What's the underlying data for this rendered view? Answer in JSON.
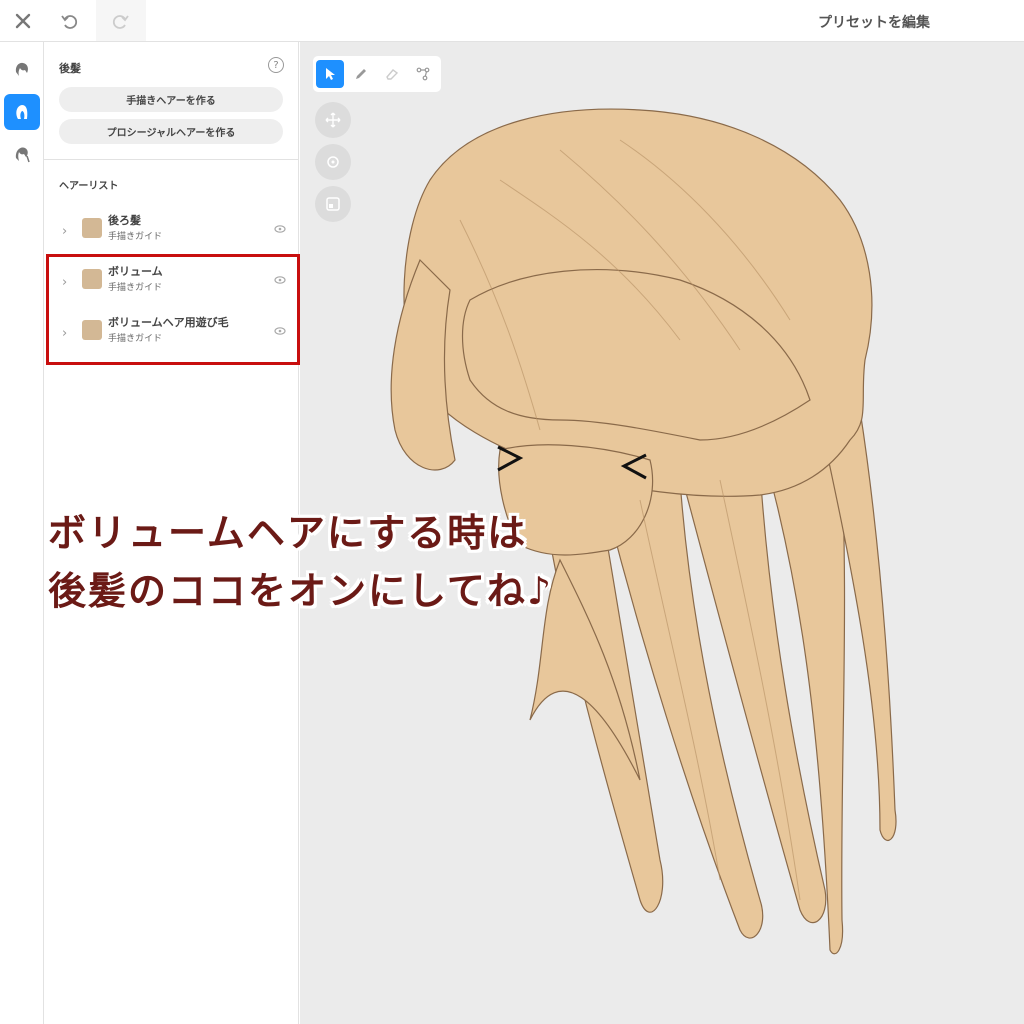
{
  "header": {
    "title": "プリセットを編集",
    "close_icon": "close-icon",
    "undo_icon": "undo-icon",
    "redo_icon": "redo-icon"
  },
  "rail": {
    "items": [
      {
        "icon": "front-hair-icon",
        "active": false
      },
      {
        "icon": "back-hair-icon",
        "active": true
      },
      {
        "icon": "side-hair-icon",
        "active": false
      }
    ],
    "accent": "#1e90ff"
  },
  "panel": {
    "section_title": "後髪",
    "help_label": "?",
    "buttons": {
      "hand_drawn": "手描きヘアーを作る",
      "procedural": "プロシージャルヘアーを作る"
    },
    "list_title": "ヘアーリスト",
    "items": [
      {
        "name": "後ろ髪",
        "sub": "手描きガイド",
        "color": "#d3b895"
      },
      {
        "name": "ボリューム",
        "sub": "手描きガイド",
        "color": "#d3b895"
      },
      {
        "name": "ボリュームヘア用遊び毛",
        "sub": "手描きガイド",
        "color": "#d3b895"
      }
    ],
    "highlight_color": "#c80e0e"
  },
  "viewport": {
    "tools": [
      "select-tool-icon",
      "pen-tool-icon",
      "eraser-tool-icon",
      "curve-tool-icon"
    ],
    "view_buttons": [
      "move-view-icon",
      "rotate-view-icon",
      "fit-view-icon"
    ],
    "background": "#ebebeb",
    "hair_color": "#e8c79b"
  },
  "caption": {
    "line1": "ボリュームヘアにする時は",
    "line2": "後髪のココをオンにしてね♪",
    "color": "#6b1a16"
  }
}
